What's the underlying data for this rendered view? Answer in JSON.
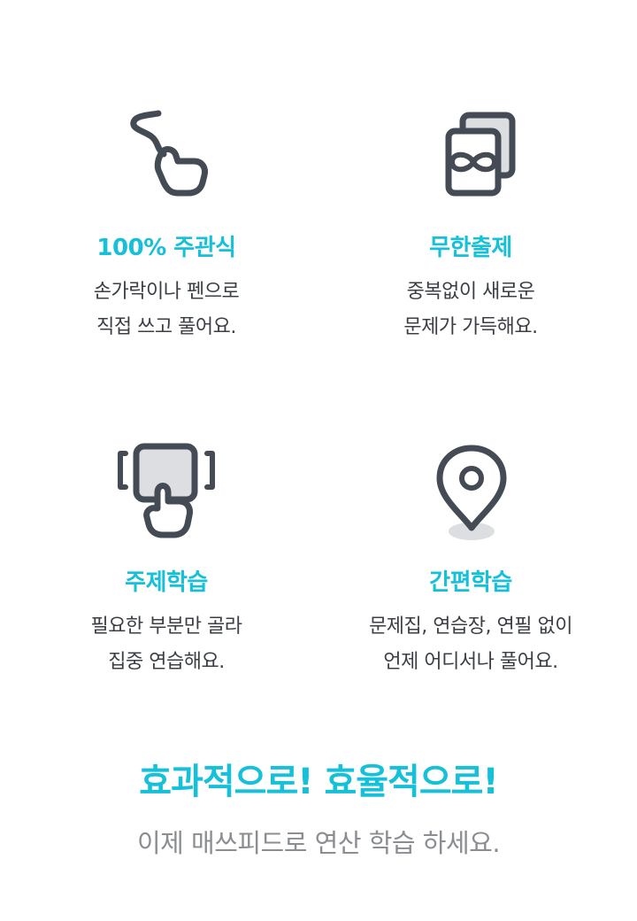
{
  "features": [
    {
      "icon": "finger-pen-icon",
      "title": "100% 주관식",
      "line1": "손가락이나 펜으로",
      "line2": "직접 쓰고 풀어요."
    },
    {
      "icon": "infinite-cards-icon",
      "title": "무한출제",
      "line1": "중복없이 새로운",
      "line2": "문제가 가득해요."
    },
    {
      "icon": "touch-select-icon",
      "title": "주제학습",
      "line1": "필요한 부분만 골라",
      "line2": "집중 연습해요."
    },
    {
      "icon": "location-pin-icon",
      "title": "간편학습",
      "line1": "문제집, 연습장, 연필 없이",
      "line2": "언제 어디서나 풀어요."
    }
  ],
  "slogan": "효과적으로! 효율적으로!",
  "sub_slogan": "이제 매쓰피드로 연산 학습 하세요.",
  "colors": {
    "accent": "#15c0d8",
    "icon_stroke": "#454b54",
    "icon_fill": "#dcdee1",
    "text": "#3b3f45",
    "muted": "#8a8d92"
  }
}
